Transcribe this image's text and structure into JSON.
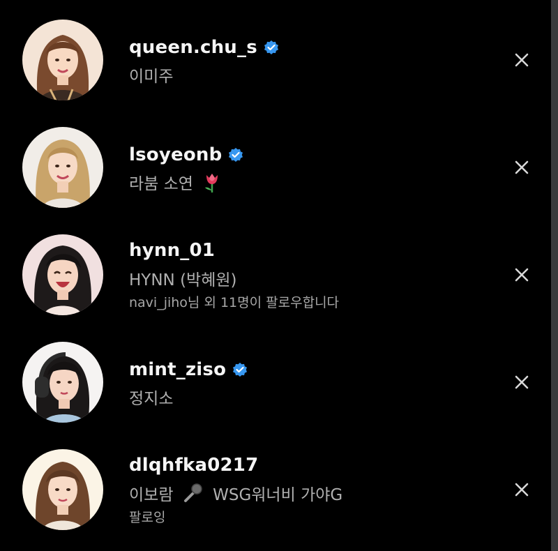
{
  "suggestions": [
    {
      "username": "queen.chu_s",
      "verified": true,
      "full_name": "이미주",
      "meta": ""
    },
    {
      "username": "lsoyeonb",
      "verified": true,
      "full_name": "라붐 소연",
      "name_emoji": "tulip",
      "meta": ""
    },
    {
      "username": "hynn_01",
      "verified": false,
      "full_name": "HYNN (박혜원)",
      "meta": "navi_jiho님 외 11명이 팔로우합니다"
    },
    {
      "username": "mint_ziso",
      "verified": true,
      "full_name": "정지소",
      "meta": ""
    },
    {
      "username": "dlqhfka0217",
      "verified": false,
      "full_name_before": "이보람",
      "name_emoji": "microphone",
      "full_name_after": "WSG워너비 가야G",
      "meta": "팔로잉"
    }
  ],
  "icons": {
    "verified": "verified-badge-icon",
    "dismiss": "close-icon"
  },
  "colors": {
    "background": "#000000",
    "verified_blue": "#3797f0",
    "secondary_text": "#a8a8a8"
  }
}
